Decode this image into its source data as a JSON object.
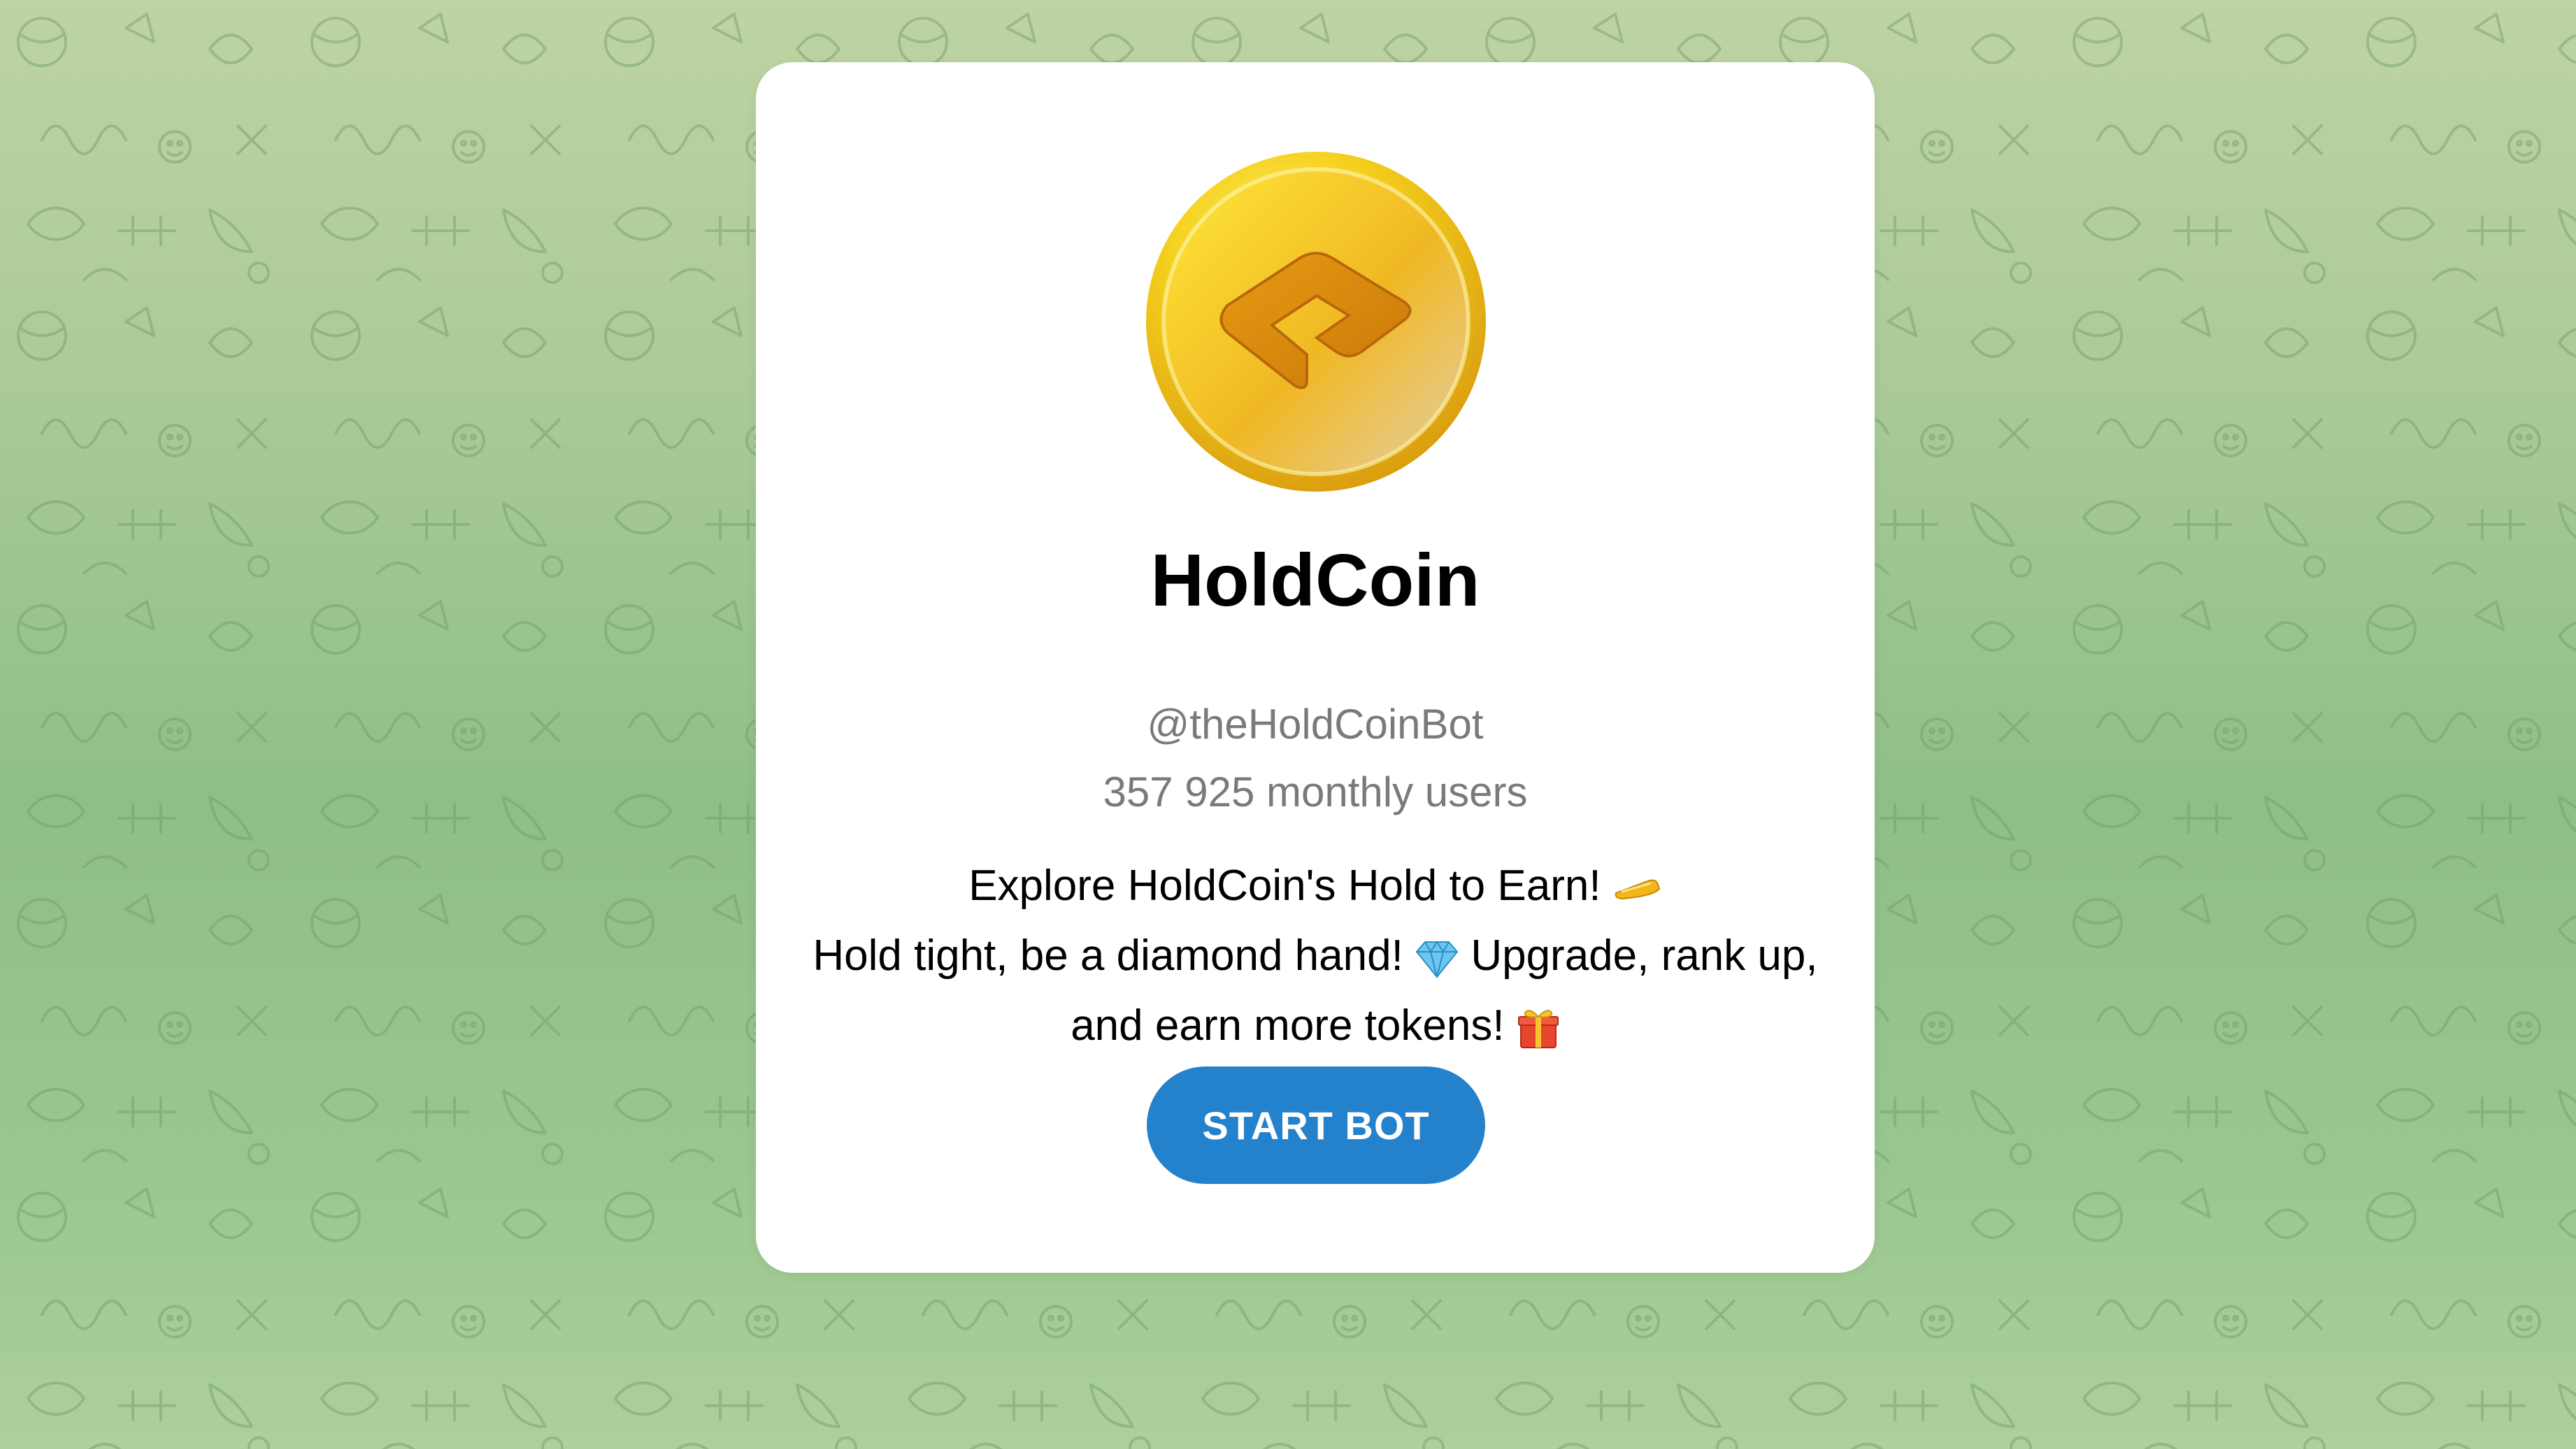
{
  "bot": {
    "name": "HoldCoin",
    "username": "@theHoldCoinBot",
    "monthly_users": "357 925 monthly users",
    "description": {
      "line1": "Explore HoldCoin's Hold to Earn!",
      "line2a": "Hold tight, be a diamond hand!",
      "line2b": "Upgrade, rank up,",
      "line3": "and earn more tokens!"
    },
    "avatar_icon": "holdcoin-gold-coin-logo"
  },
  "actions": {
    "start_label": "START BOT"
  },
  "icons": {
    "line1_emoji": "coin-bar-emoji",
    "line2_emoji": "gem-emoji",
    "line3_emoji": "gift-emoji"
  },
  "colors": {
    "button": "#2481cc",
    "secondary_text": "#7a7a7a",
    "card": "#ffffff",
    "background_green": "#9cc78f"
  }
}
